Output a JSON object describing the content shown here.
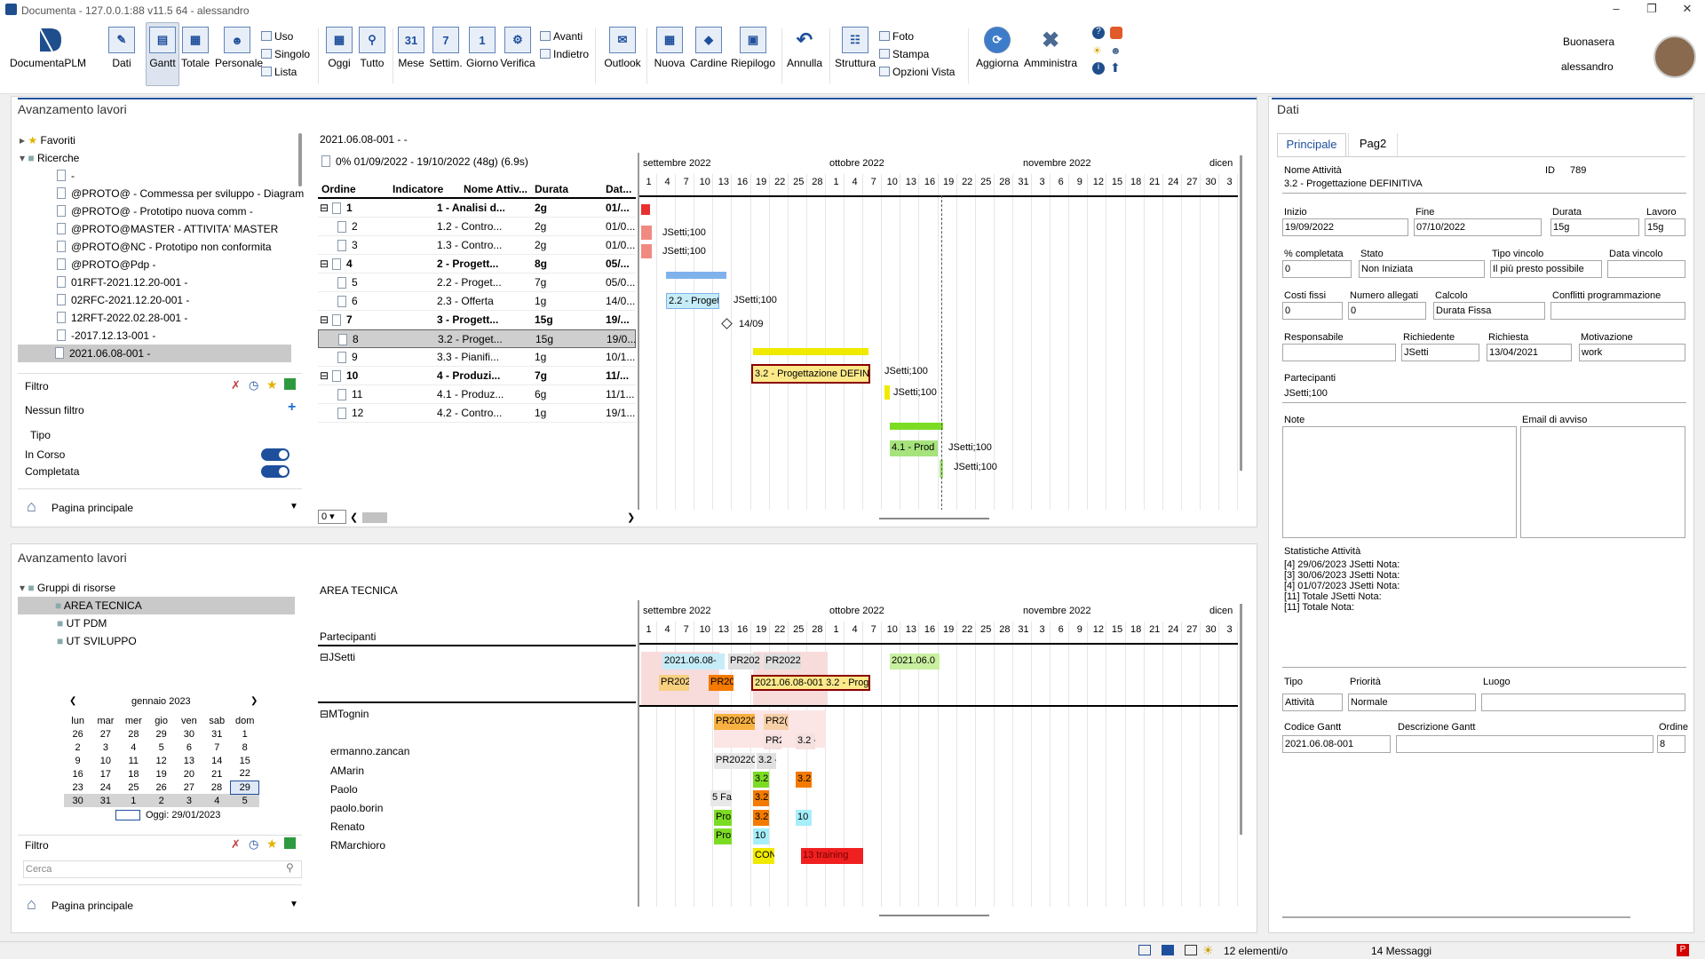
{
  "window": {
    "title": "Documenta - 127.0.0.1:88 v11.5 64 - alessandro"
  },
  "ribbon": {
    "main": "DocumentaPLM",
    "dati": "Dati",
    "gantt": "Gantt",
    "totale": "Totale",
    "personale": "Personale",
    "uso": "Uso",
    "singolo": "Singolo",
    "lista": "Lista",
    "oggi": "Oggi",
    "tutto": "Tutto",
    "mese": "Mese",
    "mese_num": "31",
    "settim": "Settim.",
    "settim_num": "7",
    "giorno": "Giorno",
    "giorno_num": "1",
    "verifica": "Verifica",
    "avanti": "Avanti",
    "indietro": "Indietro",
    "outlook": "Outlook",
    "nuova": "Nuova",
    "cardine": "Cardine",
    "riepilogo": "Riepilogo",
    "annulla": "Annulla",
    "struttura": "Struttura",
    "foto": "Foto",
    "stampa": "Stampa",
    "opzioni": "Opzioni Vista",
    "aggiorna": "Aggiorna",
    "amministra": "Amministra",
    "greeting": "Buonasera",
    "user": "alessandro"
  },
  "top_panel": {
    "title": "Avanzamento lavori",
    "tree": [
      "Favoriti",
      "Ricerche",
      "-",
      "@PROTO@ - Commessa per sviluppo - Diagram",
      "@PROTO@ - Prototipo nuova comm -",
      "@PROTO@MASTER - ATTIVITA' MASTER",
      "@PROTO@NC - Prototipo non conformita",
      "@PROTO@Pdp -",
      "01RFT-2021.12.20-001 -",
      "02RFC-2021.12.20-001 -",
      "12RFT-2022.02.28-001 -",
      "-2017.12.13-001 -",
      "2021.06.08-001 -"
    ],
    "filtro": "Filtro",
    "nessun_filtro": "Nessun filtro",
    "tipo": "Tipo",
    "in_corso": "In Corso",
    "completata": "Completata",
    "pagina": "Pagina principale",
    "project": "2021.06.08-001 -  -",
    "project_info": "0%  01/09/2022 - 19/10/2022 (48g) (6.9s)",
    "cols": [
      "Ordine",
      "Indicatore",
      "Nome Attiv...",
      "Durata",
      "Dat..."
    ],
    "rows": [
      {
        "ord": "1",
        "name": "1 - Analisi d...",
        "dur": "2g",
        "dat": "01/...",
        "bold": true,
        "exp": true
      },
      {
        "ord": "2",
        "name": "1.2 - Contro...",
        "dur": "2g",
        "dat": "01/0..."
      },
      {
        "ord": "3",
        "name": "1.3 - Contro...",
        "dur": "2g",
        "dat": "01/0..."
      },
      {
        "ord": "4",
        "name": "2 - Progett...",
        "dur": "8g",
        "dat": "05/...",
        "bold": true,
        "exp": true
      },
      {
        "ord": "5",
        "name": "2.2 - Proget...",
        "dur": "7g",
        "dat": "05/0..."
      },
      {
        "ord": "6",
        "name": "2.3 - Offerta",
        "dur": "1g",
        "dat": "14/0..."
      },
      {
        "ord": "7",
        "name": "3 - Progett...",
        "dur": "15g",
        "dat": "19/...",
        "bold": true,
        "exp": true
      },
      {
        "ord": "8",
        "name": "3.2 - Proget...",
        "dur": "15g",
        "dat": "19/0...",
        "sel": true
      },
      {
        "ord": "9",
        "name": "3.3 - Pianifi...",
        "dur": "1g",
        "dat": "10/1..."
      },
      {
        "ord": "10",
        "name": "4 - Produzi...",
        "dur": "7g",
        "dat": "11/...",
        "bold": true,
        "exp": true
      },
      {
        "ord": "11",
        "name": "4.1 - Produz...",
        "dur": "6g",
        "dat": "11/1..."
      },
      {
        "ord": "12",
        "name": "4.2 - Contro...",
        "dur": "1g",
        "dat": "19/1..."
      }
    ],
    "zoom": "0",
    "months": [
      "settembre 2022",
      "ottobre 2022",
      "novembre 2022",
      "dicen"
    ],
    "days": [
      "1",
      "4",
      "7",
      "10",
      "13",
      "16",
      "19",
      "22",
      "25",
      "28",
      "1",
      "4",
      "7",
      "10",
      "13",
      "16",
      "19",
      "22",
      "25",
      "28",
      "31",
      "3",
      "6",
      "9",
      "12",
      "15",
      "18",
      "21",
      "24",
      "27",
      "30",
      "3"
    ],
    "bars": [
      "2.2 - Progett",
      "3.2 - Progettazione DEFIN",
      "4.1 - Prod"
    ],
    "res_labels": [
      "JSetti;100",
      "JSetti;100",
      "JSetti;100",
      "JSetti;100",
      "JSetti;100",
      "JSetti;100",
      "JSetti;100"
    ],
    "milestone": "14/09"
  },
  "right_panel": {
    "title": "Dati",
    "tab1": "Principale",
    "tab2": "Pag2",
    "nome_lbl": "Nome Attività",
    "id_lbl": "ID",
    "id": "789",
    "nome": "3.2 - Progettazione DEFINITIVA",
    "inizio_lbl": "Inizio",
    "inizio": "19/09/2022",
    "fine_lbl": "Fine",
    "fine": "07/10/2022",
    "durata_lbl": "Durata",
    "durata": "15g",
    "lavoro_lbl": "Lavoro",
    "lavoro": "15g",
    "compl_lbl": "% completata",
    "compl": "0",
    "stato_lbl": "Stato",
    "stato": "Non Iniziata",
    "tipov_lbl": "Tipo vincolo",
    "tipov": "Il più presto possibile",
    "datav_lbl": "Data vincolo",
    "costi_lbl": "Costi fissi",
    "costi": "0",
    "alleg_lbl": "Numero allegati",
    "alleg": "0",
    "calc_lbl": "Calcolo",
    "calc": "Durata Fissa",
    "confl_lbl": "Conflitti programmazione",
    "resp_lbl": "Responsabile",
    "rich_lbl": "Richiedente",
    "rich": "JSetti",
    "richiesta_lbl": "Richiesta",
    "richiesta": "13/04/2021",
    "motiv_lbl": "Motivazione",
    "motiv": "work",
    "part_lbl": "Partecipanti",
    "part": "JSetti;100",
    "note_lbl": "Note",
    "email_lbl": "Email di avviso",
    "stat_lbl": "Statistiche Attività",
    "stats": [
      "[4] 29/06/2023 JSetti Nota:",
      "[3] 30/06/2023 JSetti Nota:",
      "[4] 01/07/2023 JSetti Nota:",
      "[11]  Totale JSetti Nota:",
      "[11]  Totale Nota:"
    ],
    "tipo_lbl": "Tipo",
    "tipo": "Attività",
    "prio_lbl": "Priorità",
    "prio": "Normale",
    "luogo_lbl": "Luogo",
    "codice_lbl": "Codice Gantt",
    "codice": "2021.06.08-001",
    "desc_lbl": "Descrizione  Gantt",
    "ordine_lbl": "Ordine",
    "ordine": "8"
  },
  "bottom_panel": {
    "title": "Avanzamento lavori",
    "tree": [
      "Gruppi di risorse",
      "AREA TECNICA",
      "UT PDM",
      "UT SVILUPPO"
    ],
    "area": "AREA TECNICA",
    "partecipanti": "Partecipanti",
    "cal_month": "gennaio 2023",
    "cal_head": [
      "lun",
      "mar",
      "mer",
      "gio",
      "ven",
      "sab",
      "dom"
    ],
    "cal_rows": [
      [
        "26",
        "27",
        "28",
        "29",
        "30",
        "31",
        "1"
      ],
      [
        "2",
        "3",
        "4",
        "5",
        "6",
        "7",
        "8"
      ],
      [
        "9",
        "10",
        "11",
        "12",
        "13",
        "14",
        "15"
      ],
      [
        "16",
        "17",
        "18",
        "19",
        "20",
        "21",
        "22"
      ],
      [
        "23",
        "24",
        "25",
        "26",
        "27",
        "28",
        "29"
      ],
      [
        "30",
        "31",
        "1",
        "2",
        "3",
        "4",
        "5"
      ]
    ],
    "oggi": "Oggi: 29/01/2023",
    "filtro": "Filtro",
    "cerca": "Cerca",
    "pagina": "Pagina principale",
    "people": [
      "JSetti",
      "MTognin",
      "ermanno.zancan",
      "AMarin",
      "Paolo",
      "paolo.borin",
      "Renato",
      "RMarchioro"
    ],
    "bars": [
      "2021.06.08-",
      "PR202",
      "PR2022",
      "2021.06.0",
      "PR202",
      "PR20",
      "2021.06.08-001 3.2 - Prog",
      "PR20220",
      "PR2(",
      "PR2",
      "3.2 -",
      "PR20220",
      "3.2 -",
      "3.2",
      "3.2",
      "5 Fa",
      "3.2",
      "Pro",
      "3.2",
      "10",
      "Pro",
      "10",
      "CON",
      "13 training"
    ]
  },
  "status": {
    "elementi": "12 elementi/o",
    "messaggi": "14 Messaggi"
  }
}
